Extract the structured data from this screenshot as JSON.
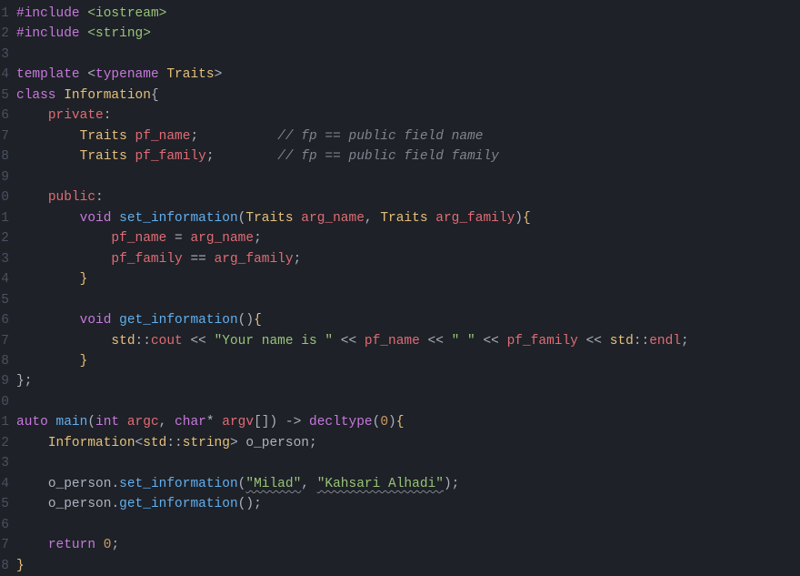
{
  "lines": {
    "l1": {
      "n": "1",
      "preproc": "#include",
      "path": "<iostream>"
    },
    "l2": {
      "n": "2",
      "preproc": "#include",
      "path": "<string>"
    },
    "l3": {
      "n": "3"
    },
    "l4": {
      "n": "4",
      "template": "template",
      "typename": "typename",
      "param": "Traits"
    },
    "l5": {
      "n": "5",
      "class": "class",
      "name": "Information"
    },
    "l6": {
      "n": "6",
      "access": "private"
    },
    "l7": {
      "n": "7",
      "type": "Traits",
      "var": "pf_name",
      "comment": "// fp == public field name"
    },
    "l8": {
      "n": "8",
      "type": "Traits",
      "var": "pf_family",
      "comment": "// fp == public field family"
    },
    "l9": {
      "n": "9"
    },
    "l10": {
      "n": "0",
      "access": "public"
    },
    "l11": {
      "n": "1",
      "void": "void",
      "fn": "set_information",
      "t1": "Traits",
      "p1": "arg_name",
      "t2": "Traits",
      "p2": "arg_family"
    },
    "l12": {
      "n": "2",
      "lhs": "pf_name",
      "rhs": "arg_name"
    },
    "l13": {
      "n": "3",
      "lhs": "pf_family",
      "rhs": "arg_family"
    },
    "l14": {
      "n": "4"
    },
    "l15": {
      "n": "5"
    },
    "l16": {
      "n": "6",
      "void": "void",
      "fn": "get_information"
    },
    "l17": {
      "n": "7",
      "std": "std",
      "cout": "cout",
      "s1": "\"Your name is \"",
      "v1": "pf_name",
      "s2": "\" \"",
      "v2": "pf_family",
      "endl": "endl"
    },
    "l18": {
      "n": "8"
    },
    "l19": {
      "n": "9"
    },
    "l20": {
      "n": "0"
    },
    "l21": {
      "n": "1",
      "auto": "auto",
      "main": "main",
      "int": "int",
      "argc": "argc",
      "char": "char",
      "argv": "argv",
      "decltype": "decltype",
      "zero": "0"
    },
    "l22": {
      "n": "2",
      "cls": "Information",
      "std": "std",
      "string": "string",
      "obj": "o_person"
    },
    "l23": {
      "n": "3"
    },
    "l24": {
      "n": "4",
      "obj": "o_person",
      "fn": "set_information",
      "s1": "\"Milad\"",
      "s2": "\"Kahsari Alhadi\""
    },
    "l25": {
      "n": "5",
      "obj": "o_person",
      "fn": "get_information"
    },
    "l26": {
      "n": "6"
    },
    "l27": {
      "n": "7",
      "return": "return",
      "zero": "0"
    },
    "l28": {
      "n": "8"
    }
  }
}
